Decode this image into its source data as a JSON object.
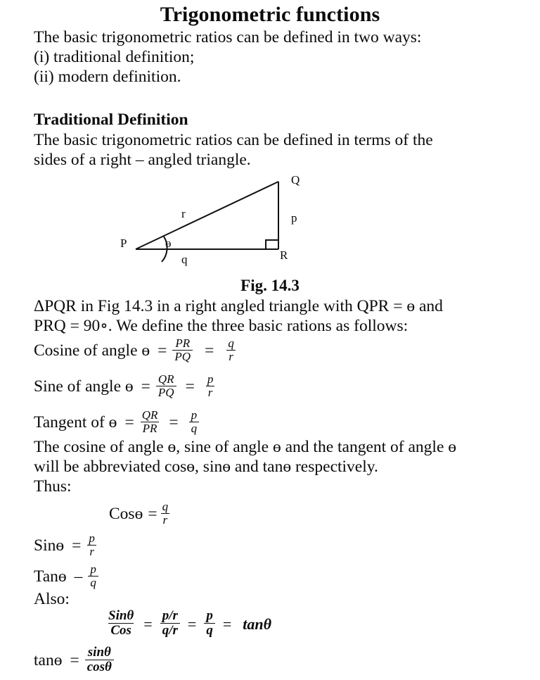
{
  "document": {
    "title": "Trigonometric functions",
    "intro": {
      "line1": "The basic trigonometric ratios can be defined in two ways:",
      "line2": "(i) traditional definition;",
      "line3": "(ii) modern definition."
    },
    "traditional": {
      "heading": "Traditional Definition",
      "line1": "The basic trigonometric ratios can be defined in terms of the",
      "line2": "sides of a right – angled triangle."
    },
    "figure": {
      "caption": "Fig. 14.3",
      "vertex_p": "P",
      "vertex_q": "Q",
      "vertex_r": "R",
      "side_hypotenuse": "r",
      "side_opposite": "p",
      "side_adjacent": "q",
      "angle_symbol": "ɵ"
    },
    "description": {
      "line1": "ΔPQR in Fig 14.3 in a right angled triangle with QPR = ɵ and",
      "line2": "PRQ = 90∘. We define the three basic rations as follows:"
    },
    "ratios": [
      {
        "label": "Cosine of angle ɵ",
        "eq1": "=",
        "num1": "PR",
        "den1": "PQ",
        "eq2": "=",
        "num2": "q",
        "den2": "r"
      },
      {
        "label": "Sine of angle ɵ",
        "eq1": "=",
        "num1": "QR",
        "den1": "PQ",
        "eq2": "=",
        "num2": "p",
        "den2": "r"
      },
      {
        "label": "Tangent of ɵ",
        "eq1": "=",
        "num1": "QR",
        "den1": "PR",
        "eq2": "=",
        "num2": "p",
        "den2": "q"
      }
    ],
    "abbreviation": {
      "line1": "The cosine of angle ɵ, sine of angle ɵ and the tangent of angle ɵ",
      "line2": "will be abbreviated cosɵ, sinɵ and tanɵ respectively.",
      "line3": "Thus:"
    },
    "thus": [
      {
        "label": "Cosɵ",
        "eq": "=",
        "num": "q",
        "den": "r"
      },
      {
        "label": "Sinɵ",
        "eq": "=",
        "num": "p",
        "den": "r"
      },
      {
        "label": "Tanɵ",
        "eq": "–",
        "num": "p",
        "den": "q"
      }
    ],
    "also": {
      "heading": "Also:",
      "identity": {
        "num1": "Sinθ",
        "den1": "Cos",
        "eq1": "=",
        "num2": "p/r",
        "den2": "q/r",
        "eq2": "=",
        "num3": "p",
        "den3": "q",
        "eq3": "=",
        "result": "tanθ"
      },
      "final": {
        "label": "tanɵ",
        "eq": "=",
        "num": "sinθ",
        "den": "cosθ"
      }
    },
    "colors": {
      "ink": "#0b0b0b",
      "paper": "#ffffff"
    }
  }
}
